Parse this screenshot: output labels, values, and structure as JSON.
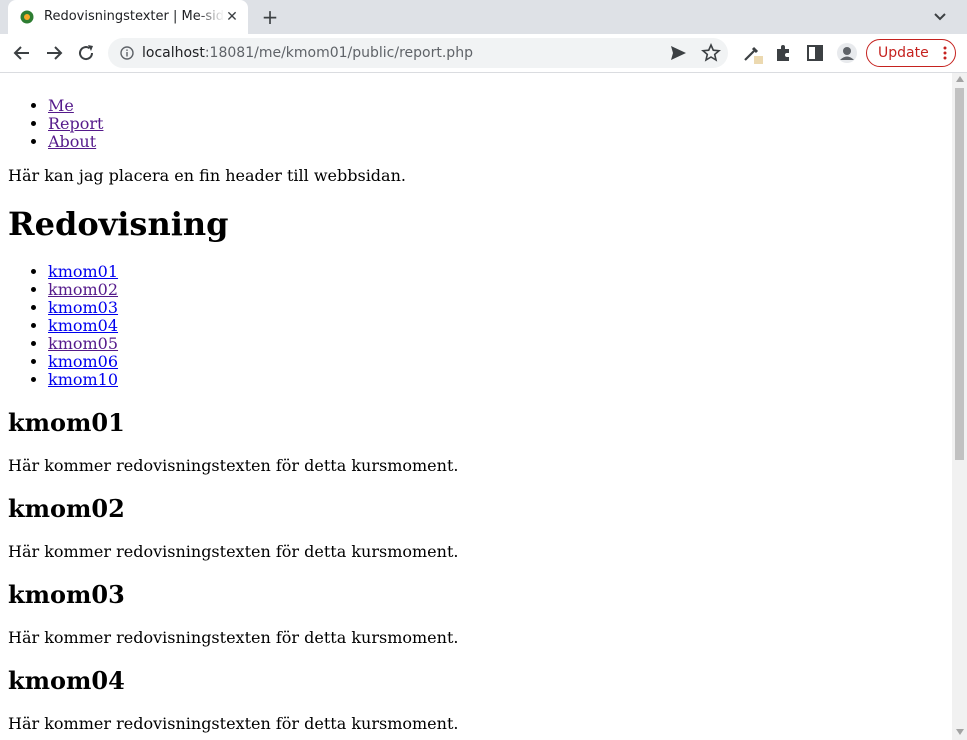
{
  "browser": {
    "tab_title": "Redovisningstexter | Me-sida",
    "url_host": "localhost",
    "url_path": ":18081/me/kmom01/public/report.php",
    "update_label": "Update"
  },
  "nav": {
    "items": [
      {
        "label": "Me",
        "visited": true
      },
      {
        "label": "Report",
        "visited": true
      },
      {
        "label": "About",
        "visited": true
      }
    ]
  },
  "header_text": "Här kan jag placera en fin header till webbsidan.",
  "page_title": "Redovisning",
  "toc": [
    {
      "label": "kmom01",
      "visited": false
    },
    {
      "label": "kmom02",
      "visited": true
    },
    {
      "label": "kmom03",
      "visited": false
    },
    {
      "label": "kmom04",
      "visited": false
    },
    {
      "label": "kmom05",
      "visited": true
    },
    {
      "label": "kmom06",
      "visited": false
    },
    {
      "label": "kmom10",
      "visited": false
    }
  ],
  "sections": [
    {
      "heading": "kmom01",
      "text": "Här kommer redovisningstexten för detta kursmoment."
    },
    {
      "heading": "kmom02",
      "text": "Här kommer redovisningstexten för detta kursmoment."
    },
    {
      "heading": "kmom03",
      "text": "Här kommer redovisningstexten för detta kursmoment."
    },
    {
      "heading": "kmom04",
      "text": "Här kommer redovisningstexten för detta kursmoment."
    }
  ]
}
